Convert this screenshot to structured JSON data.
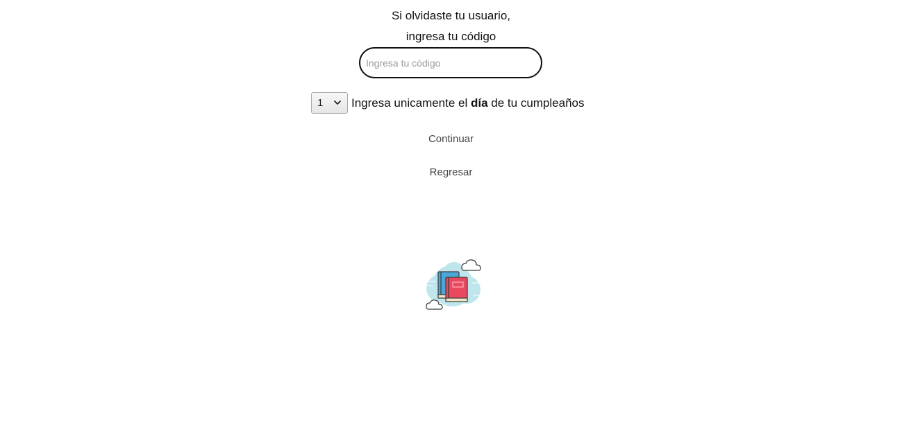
{
  "header": {
    "line1": "Si olvidaste tu usuario,",
    "line2": "ingresa tu código"
  },
  "code_input": {
    "value": "",
    "placeholder": "Ingresa tu código"
  },
  "birthday": {
    "selected_day": "1",
    "label_before": "Ingresa unicamente el ",
    "label_bold": "día",
    "label_after": " de tu cumpleaños"
  },
  "actions": {
    "continue_label": "Continuar",
    "back_label": "Regresar"
  },
  "illustration": {
    "icon": "books-clouds-icon",
    "colors": {
      "cloud_bg": "#bfe6ec",
      "book_front": "#e9485e",
      "book_back": "#4aa8d8",
      "pages": "#f3e6c8",
      "outline": "#3a3a3a"
    }
  }
}
